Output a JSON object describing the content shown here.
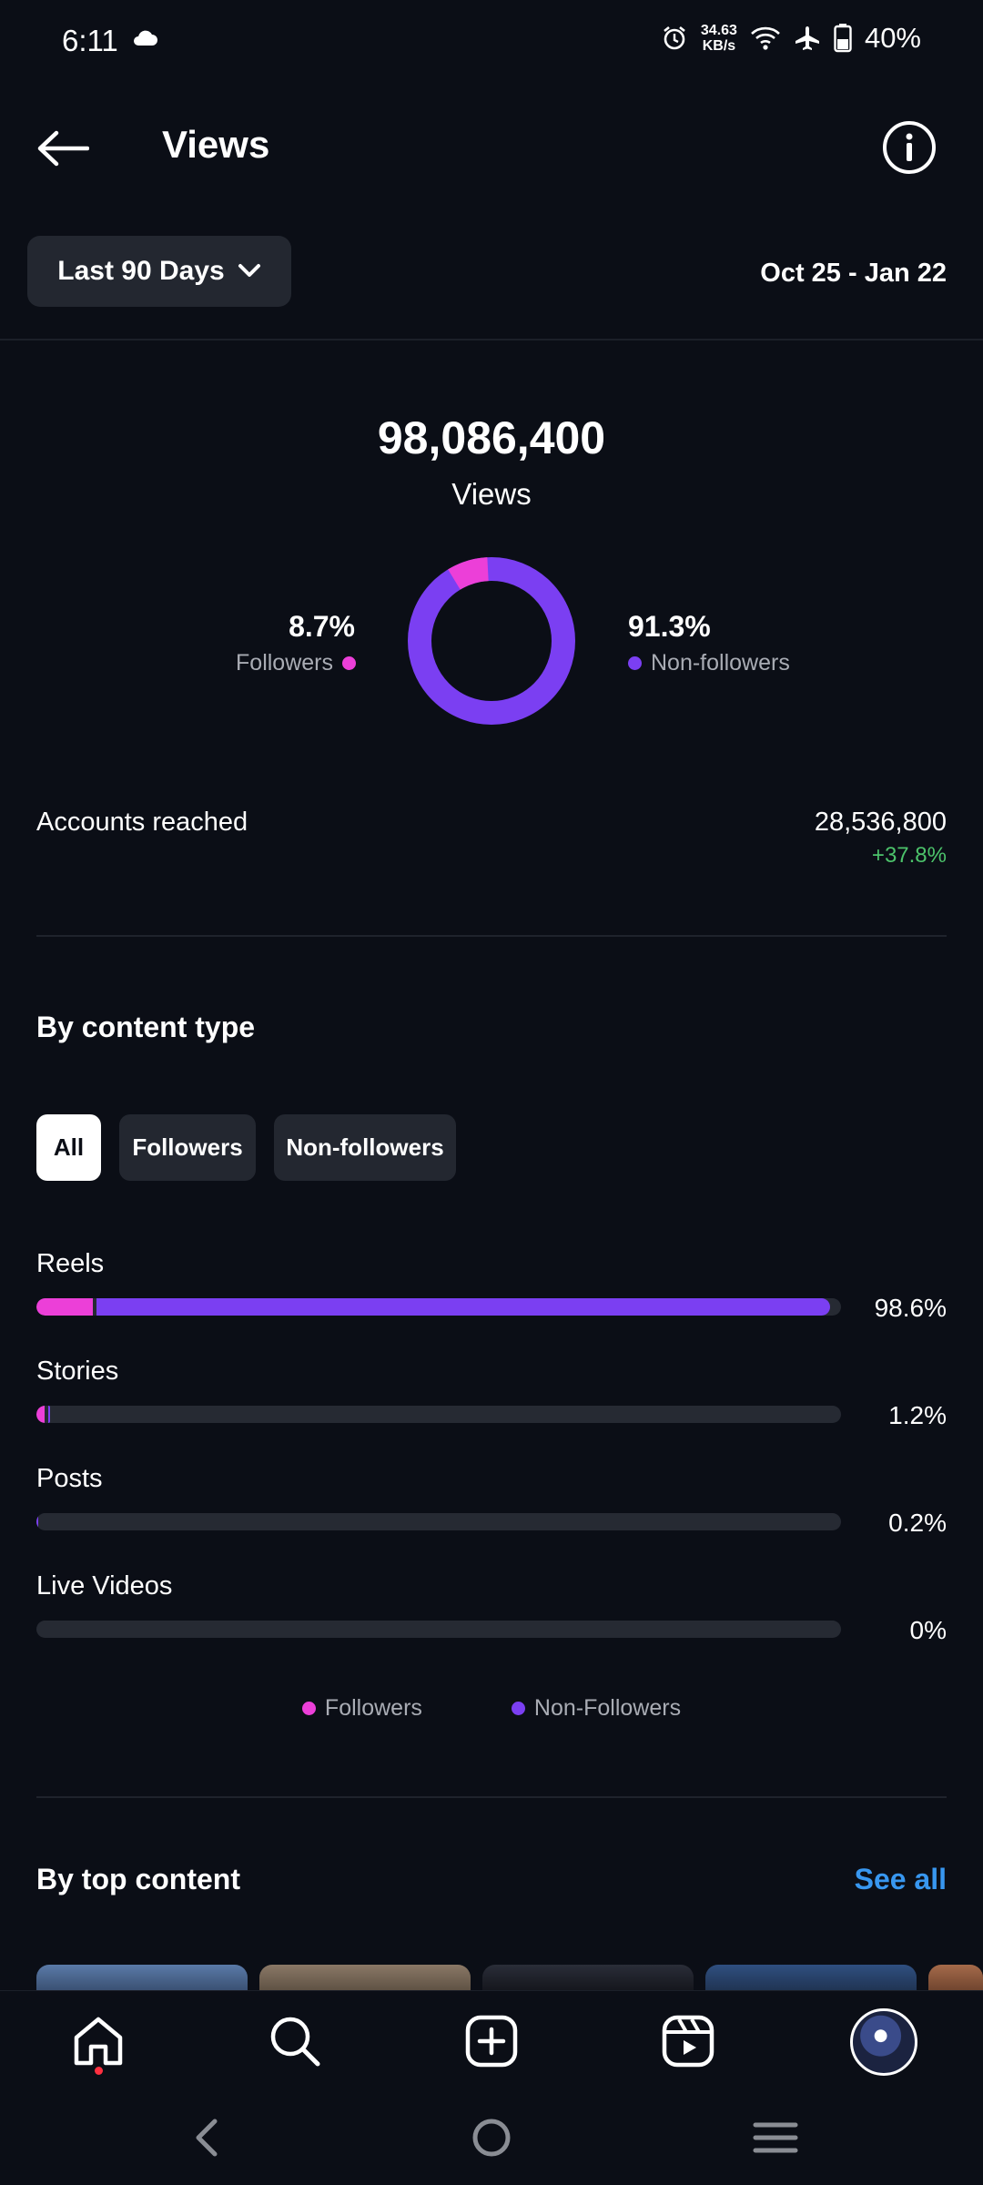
{
  "status_bar": {
    "time": "6:11",
    "net_speed_value": "34.63",
    "net_speed_unit": "KB/s",
    "battery": "40%"
  },
  "header": {
    "title": "Views"
  },
  "period": {
    "selector_label": "Last 90 Days",
    "date_range": "Oct 25 - Jan 22"
  },
  "summary": {
    "total_views": "98,086,400",
    "total_label": "Views",
    "followers_pct": "8.7%",
    "followers_label": "Followers",
    "non_followers_pct": "91.3%",
    "non_followers_label": "Non-followers",
    "followers_fraction": 0.087
  },
  "reach": {
    "label": "Accounts reached",
    "value": "28,536,800",
    "change": "+37.8%"
  },
  "content_type": {
    "title": "By content type",
    "filters": [
      "All",
      "Followers",
      "Non-followers"
    ],
    "active_filter": "All",
    "rows": [
      {
        "label": "Reels",
        "pct_text": "98.6%",
        "followers_pct": 7.0,
        "non_followers_pct": 91.6
      },
      {
        "label": "Stories",
        "pct_text": "1.2%",
        "followers_pct": 1.0,
        "non_followers_pct": 0.2
      },
      {
        "label": "Posts",
        "pct_text": "0.2%",
        "followers_pct": 0.0,
        "non_followers_pct": 0.2
      },
      {
        "label": "Live Videos",
        "pct_text": "0%",
        "followers_pct": 0.0,
        "non_followers_pct": 0.0
      }
    ],
    "legend_followers": "Followers",
    "legend_non_followers": "Non-Followers"
  },
  "top_content": {
    "title": "By top content",
    "see_all": "See all"
  },
  "colors": {
    "followers": "#ec3fd8",
    "non_followers": "#7b3ff2",
    "positive": "#4cc36b",
    "link": "#3897f0"
  }
}
